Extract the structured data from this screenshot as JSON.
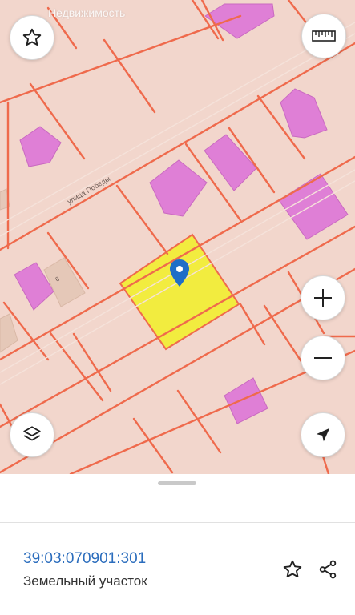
{
  "app": {
    "watermark": "Недвижимость"
  },
  "map": {
    "street_label": "улица Победы",
    "house_number": "6",
    "colors": {
      "background": "#f2d6cc",
      "boundary": "#ef6a4c",
      "building": "#df7fd6",
      "selected_parcel": "#f2ec3f",
      "pin": "#1f6ec7"
    }
  },
  "controls": {
    "favorite": {
      "icon": "star-outline-icon"
    },
    "ruler": {
      "icon": "ruler-icon"
    },
    "zoom_in": {
      "icon": "plus-icon"
    },
    "zoom_out": {
      "icon": "minus-icon"
    },
    "layers": {
      "icon": "layers-icon"
    },
    "locate": {
      "icon": "navigation-arrow-icon"
    }
  },
  "parcel": {
    "cadastral_number": "39:03:070901:301",
    "type": "Земельный участок"
  },
  "sheet_actions": {
    "favorite_icon": "star-outline-icon",
    "share_icon": "share-icon"
  }
}
